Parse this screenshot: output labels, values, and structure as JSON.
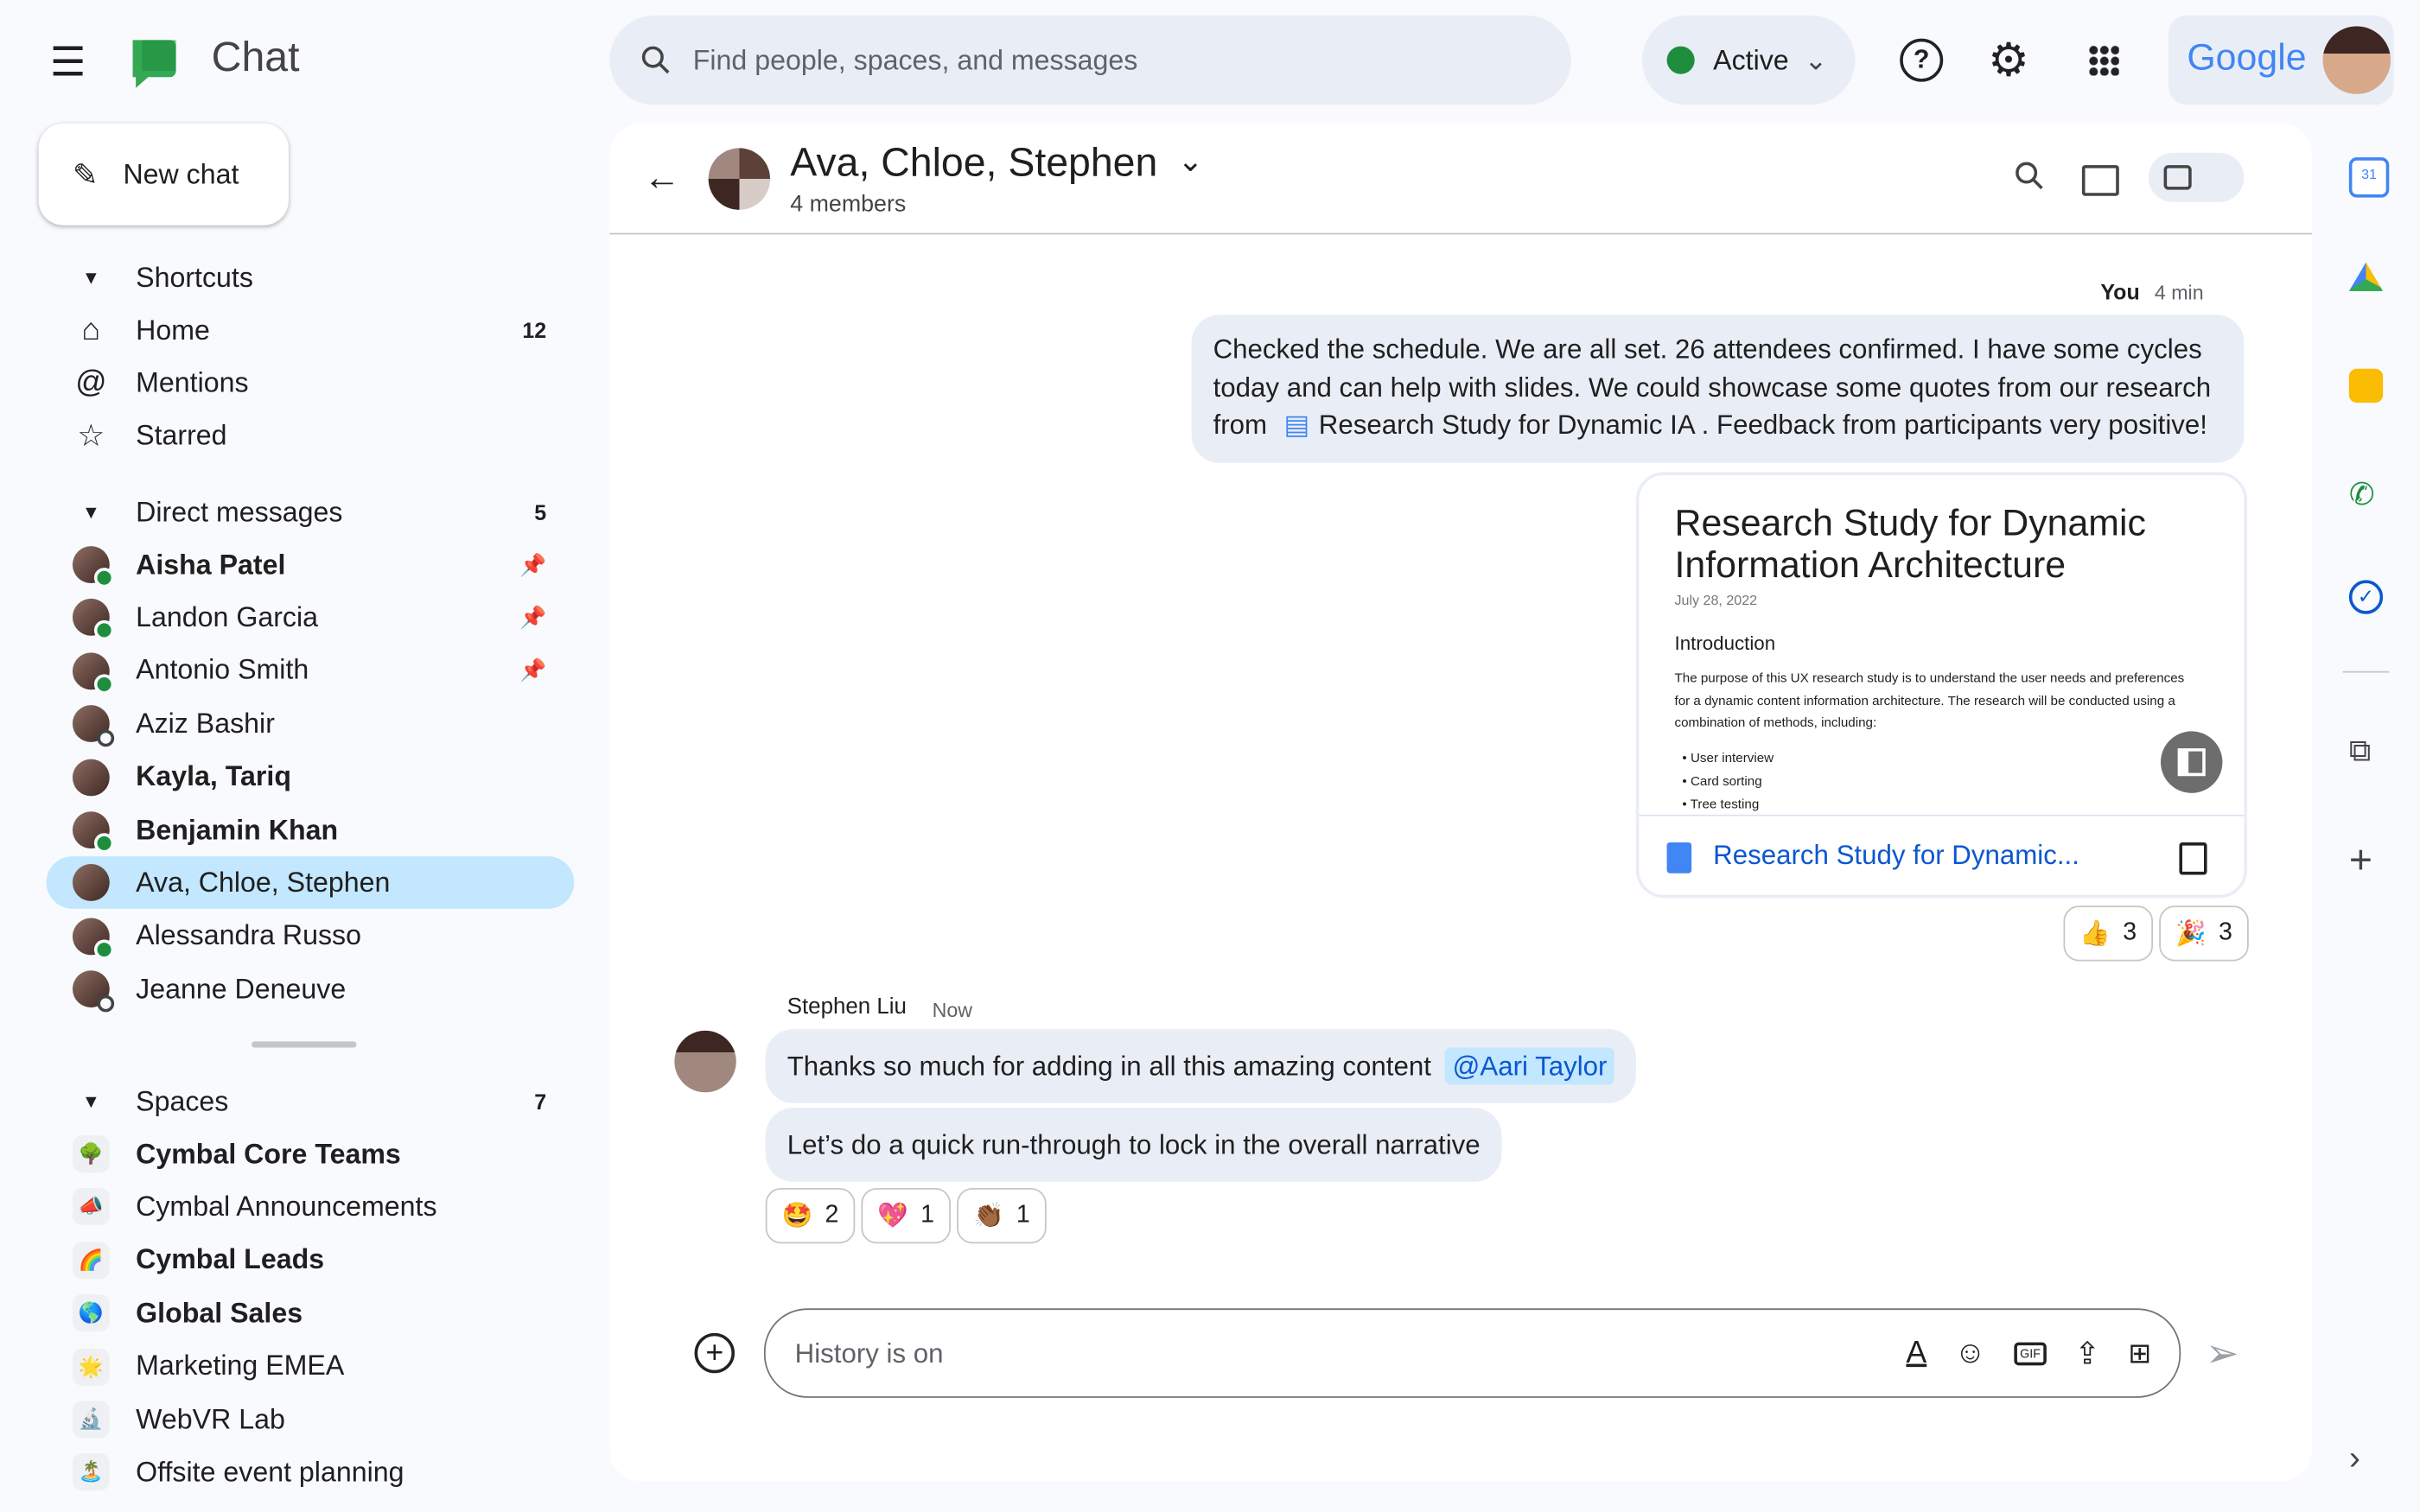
{
  "app": {
    "title": "Chat",
    "search_placeholder": "Find people, spaces, and messages",
    "status": "Active",
    "google": "Google"
  },
  "sidebar": {
    "new_chat": "New chat",
    "shortcuts": {
      "label": "Shortcuts",
      "items": [
        {
          "label": "Home",
          "count": "12"
        },
        {
          "label": "Mentions"
        },
        {
          "label": "Starred"
        }
      ]
    },
    "dms": {
      "label": "Direct messages",
      "count": "5",
      "items": [
        {
          "label": "Aisha Patel",
          "bold": true,
          "pinned": true,
          "online": true
        },
        {
          "label": "Landon Garcia",
          "pinned": true,
          "online": true
        },
        {
          "label": "Antonio Smith",
          "pinned": true,
          "online": true
        },
        {
          "label": "Aziz Bashir",
          "online": false
        },
        {
          "label": "Kayla, Tariq",
          "bold": true
        },
        {
          "label": "Benjamin Khan",
          "bold": true,
          "online": true
        },
        {
          "label": "Ava, Chloe, Stephen",
          "selected": true
        },
        {
          "label": "Alessandra Russo",
          "online": true
        },
        {
          "label": "Jeanne Deneuve",
          "online": false
        }
      ]
    },
    "spaces": {
      "label": "Spaces",
      "count": "7",
      "items": [
        {
          "label": "Cymbal Core Teams",
          "bold": true,
          "emoji": "🌳"
        },
        {
          "label": "Cymbal Announcements",
          "emoji": "📣"
        },
        {
          "label": "Cymbal Leads",
          "bold": true,
          "emoji": "🌈"
        },
        {
          "label": "Global Sales",
          "bold": true,
          "emoji": "🌎"
        },
        {
          "label": "Marketing EMEA",
          "emoji": "🌟"
        },
        {
          "label": "WebVR Lab",
          "emoji": "🔬"
        },
        {
          "label": "Offsite event planning",
          "emoji": "🏝️"
        }
      ]
    }
  },
  "conversation": {
    "title": "Ava, Chloe, Stephen",
    "members": "4 members",
    "my_message": {
      "author": "You",
      "time": "4 min",
      "text_a": "Checked the schedule.  We are all set.  26 attendees confirmed. I have some cycles today and can help with slides.  We could showcase some quotes from our research from ",
      "doc_chip": "Research Study for Dynamic IA",
      "text_b": " . Feedback from participants very positive!"
    },
    "doc_card": {
      "title": "Research Study for Dynamic Information Architecture",
      "date": "July 28, 2022",
      "heading": "Introduction",
      "body": "The purpose of this UX research study is to understand the user needs and preferences for a dynamic content information architecture. The research will be conducted using a combination of methods, including:",
      "bullets": [
        "User interview",
        "Card sorting",
        "Tree testing"
      ],
      "link": "Research Study for Dynamic..."
    },
    "my_reactions": [
      {
        "emoji": "👍",
        "count": "3"
      },
      {
        "emoji": "🎉",
        "count": "3"
      }
    ],
    "reply": {
      "author": "Stephen Liu",
      "time": "Now",
      "msg1": "Thanks so much for adding in all this amazing content ",
      "mention": "@Aari Taylor",
      "msg2": "Let’s do a quick run-through to lock in the overall narrative"
    },
    "reply_reactions": [
      {
        "emoji": "🤩",
        "count": "2"
      },
      {
        "emoji": "💖",
        "count": "1"
      },
      {
        "emoji": "👏🏾",
        "count": "1"
      }
    ],
    "composer_placeholder": "History is on"
  },
  "colors": {
    "accent": "#0b57d0",
    "selected": "#c2e7ff",
    "online": "#1e8e3e"
  }
}
